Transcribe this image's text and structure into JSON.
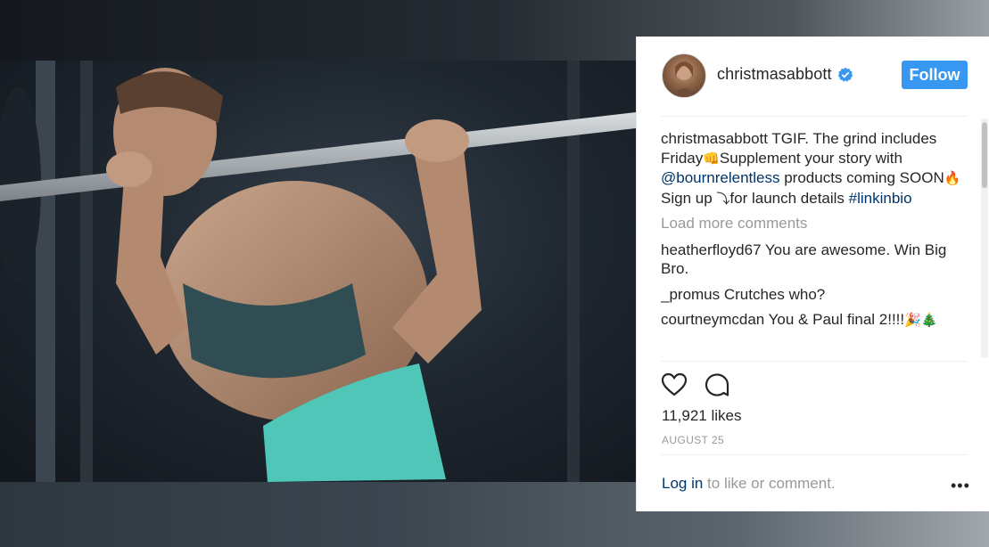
{
  "post": {
    "username": "christmasabbott",
    "follow_label": "Follow",
    "caption": {
      "username": "christmasabbott",
      "text_1": " TGIF. The grind includes Friday",
      "emoji_1": "👊",
      "text_2": "Supplement your story with ",
      "mention": "@bournrelentless",
      "text_3": " products coming SOON",
      "emoji_2": "🔥",
      "text_4": "Sign up ",
      "emoji_3": "⤵",
      "text_5": "for launch details ",
      "hashtag": "#linkinbio"
    },
    "load_more": "Load more comments",
    "comments": [
      {
        "username": "heatherfloyd67",
        "text": " You are awesome. Win Big Bro."
      },
      {
        "username": "_promus",
        "text": " Crutches who?"
      },
      {
        "username": "courtneymcdan",
        "text": " You & Paul final 2!!!!",
        "emoji": "🎉🎄"
      }
    ],
    "likes": "11,921 likes",
    "date": "AUGUST 25",
    "login_link": "Log in",
    "login_text": " to like or comment.",
    "more_label": "•••"
  },
  "colors": {
    "accent": "#3897f0",
    "link": "#003569",
    "muted": "#999999",
    "text": "#262626"
  },
  "icons": [
    "verified-badge-icon",
    "heart-icon",
    "comment-icon",
    "more-options-icon"
  ]
}
